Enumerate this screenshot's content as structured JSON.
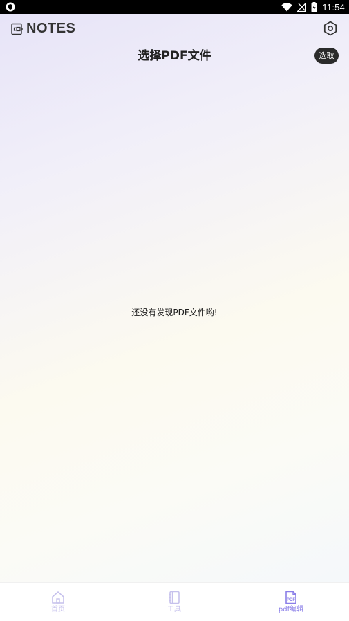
{
  "status_bar": {
    "time": "11:54",
    "icons": [
      "shield-icon",
      "wifi-icon",
      "no-signal-icon",
      "battery-charging-icon"
    ]
  },
  "header": {
    "logo_text": "NOTES",
    "logo_icon": "note-icon",
    "settings_icon": "hexagon-settings-icon",
    "page_title": "选择PDF文件",
    "select_button_label": "选取"
  },
  "main": {
    "empty_message": "还没有发现PDF文件哟!"
  },
  "bottom_nav": {
    "items": [
      {
        "label": "首页",
        "icon": "home-icon",
        "active": false
      },
      {
        "label": "工具",
        "icon": "notebook-icon",
        "active": false
      },
      {
        "label": "pdf编辑",
        "icon": "pdf-file-icon",
        "active": true
      }
    ]
  },
  "colors": {
    "accent": "#8a7ee8",
    "inactive_nav": "#c6c1ec",
    "select_button_bg": "#2b2b2b"
  }
}
